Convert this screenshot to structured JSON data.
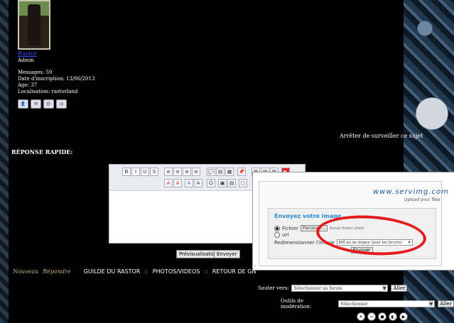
{
  "profile": {
    "username": "Rastor",
    "role": "Admin",
    "messages": "Messages: 59",
    "inscription": "Date d'inscription: 13/06/2013",
    "age": "Age: 37",
    "localisation": "Localisation: rastorland",
    "icons": [
      "profile-icon",
      "pm-icon",
      "email-icon",
      "website-icon"
    ]
  },
  "topic": {
    "stop_watching": "Arrêter de surveiller ce sujet",
    "quick_reply": "RÉPONSE RAPIDE:"
  },
  "editor": {
    "toolbar_row1": [
      "B",
      "I",
      "U",
      "S",
      "≡",
      "≡",
      "≡",
      "≡",
      "≡",
      "💬",
      "▤",
      "▦",
      "📌",
      "▥",
      "▧",
      "▨",
      "▶"
    ],
    "toolbar_row2": [
      "A",
      "A",
      "A",
      "A",
      "☺",
      "▣",
      "▤",
      "▢"
    ],
    "preview_button": "Prévisualisation",
    "send_button": "Envoyer"
  },
  "nav": {
    "new_label": "Nouveau",
    "reply_label": "Répondre",
    "links": [
      "GUILDE DU RASTOR",
      "PHOTOS/VIDEOS",
      "RETOUR DE GN"
    ],
    "separator": "::"
  },
  "forms": {
    "jump_label": "Sauter vers:",
    "jump_select": "Sélectionner un forum",
    "jump_button": "Aller",
    "mod_label": "Outils de modération:",
    "mod_select": "Sélectionner",
    "mod_button": "Aller"
  },
  "popup": {
    "logo": "www.servimg.com",
    "tagline": "Upload your files",
    "title": "Envoyez votre image",
    "file_label": "Fichier",
    "browse_button": "Parcourir...",
    "no_file": "Aucun fichier choisi",
    "url_label": "url",
    "resize_label": "Redimensionner l'image",
    "resize_value": "800 px de largeur (pour les forums)",
    "send_button": "Envoyer",
    "footer": "v"
  },
  "colors": {
    "accent": "#2a8ad4",
    "highlight": "#e41b1b"
  }
}
